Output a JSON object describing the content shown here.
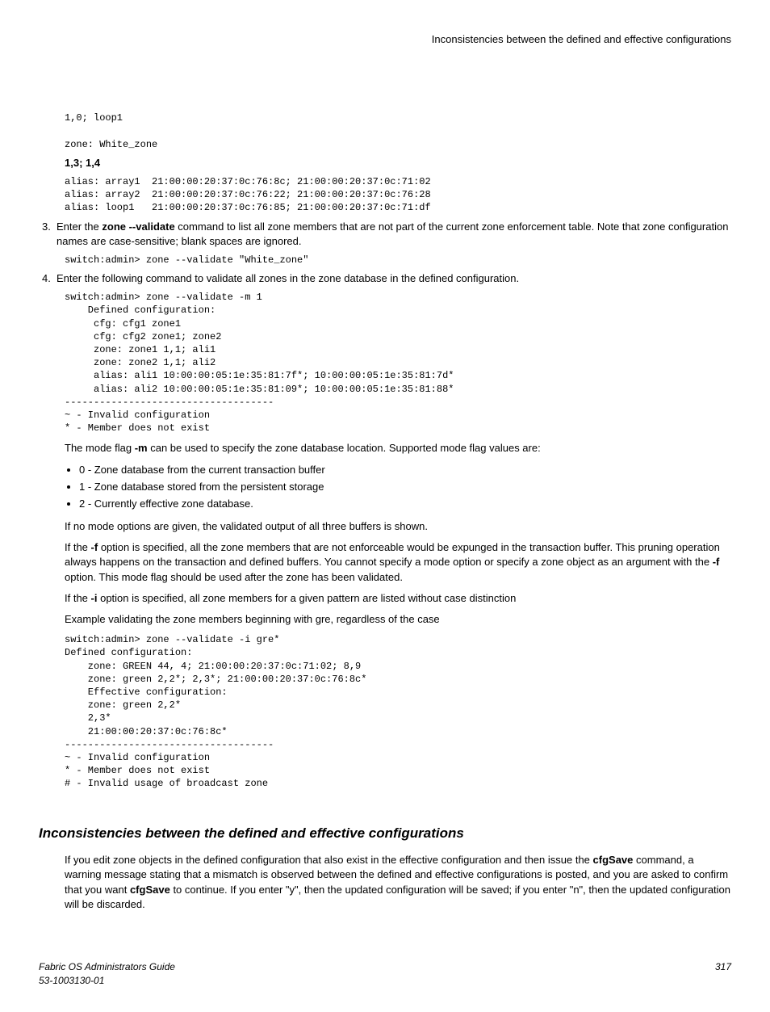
{
  "running_head": "Inconsistencies between the defined and effective configurations",
  "preblock1": "1,0; loop1\n\nzone: White_zone",
  "strong_1314": "1,3; 1,4",
  "preblock_aliases": "alias: array1  21:00:00:20:37:0c:76:8c; 21:00:00:20:37:0c:71:02\nalias: array2  21:00:00:20:37:0c:76:22; 21:00:00:20:37:0c:76:28\nalias: loop1   21:00:00:20:37:0c:76:85; 21:00:00:20:37:0c:71:df",
  "step3": {
    "num": "3.",
    "pre": "Enter the ",
    "cmd": "zone --validate",
    "post": " command to list all zone members that are not part of the current zone enforcement table. Note that zone configuration names are case-sensitive; blank spaces are ignored."
  },
  "cmd3_block": "switch:admin> zone --validate \"White_zone\"",
  "step4": {
    "num": "4.",
    "text": "Enter the following command to validate all zones in the zone database in the defined configuration."
  },
  "cmd4_block": "switch:admin> zone --validate -m 1\n    Defined configuration:\n     cfg: cfg1 zone1\n     cfg: cfg2 zone1; zone2\n     zone: zone1 1,1; ali1\n     zone: zone2 1,1; ali2\n     alias: ali1 10:00:00:05:1e:35:81:7f*; 10:00:00:05:1e:35:81:7d*\n     alias: ali2 10:00:00:05:1e:35:81:09*; 10:00:00:05:1e:35:81:88*\n------------------------------------\n~ - Invalid configuration\n* - Member does not exist",
  "mode_intro_pre": "The mode flag ",
  "mode_flag": "-m",
  "mode_intro_post": " can be used to specify the zone database location. Supported mode flag values are:",
  "modes": [
    "0 - Zone database from the current transaction buffer",
    "1 - Zone database stored from the persistent storage",
    "2 - Currently effective zone database."
  ],
  "no_mode": "If no mode options are given, the validated output of all three buffers is shown.",
  "f_opt": {
    "pre": "If the ",
    "flag1": "-f",
    "mid": " option is specified, all the zone members that are not enforceable would be expunged in the transaction buffer. This pruning operation always happens on the transaction and defined buffers. You cannot specify a mode option or specify a zone object as an argument with the ",
    "flag2": "-f",
    "post": " option. This mode flag should be used after the zone has been validated."
  },
  "i_opt": {
    "pre": "If the ",
    "flag": "-i",
    "post": " option is specified, all zone members for a given pattern are listed without case distinction"
  },
  "example_intro": "Example validating the zone members beginning with gre, regardless of the case",
  "example_block": "switch:admin> zone --validate -i gre*\nDefined configuration:\n    zone: GREEN 44, 4; 21:00:00:20:37:0c:71:02; 8,9\n    zone: green 2,2*; 2,3*; 21:00:00:20:37:0c:76:8c*\n    Effective configuration:\n    zone: green 2,2*\n    2,3*\n    21:00:00:20:37:0c:76:8c*\n------------------------------------\n~ - Invalid configuration\n* - Member does not exist\n# - Invalid usage of broadcast zone",
  "section_heading": "Inconsistencies between the defined and effective configurations",
  "section_body": {
    "pre": "If you edit zone objects in the defined configuration that also exist in the effective configuration and then issue the ",
    "cmd1": "cfgSave",
    "mid": " command, a warning message stating that a mismatch is observed between the defined and effective configurations is posted, and you are asked to confirm that you want ",
    "cmd2": "cfgSave",
    "post": " to continue. If you enter \"y\", then the updated configuration will be saved; if you enter \"n\", then the updated configuration will be discarded."
  },
  "footer": {
    "title": "Fabric OS Administrators Guide",
    "doc": "53-1003130-01",
    "page": "317"
  }
}
